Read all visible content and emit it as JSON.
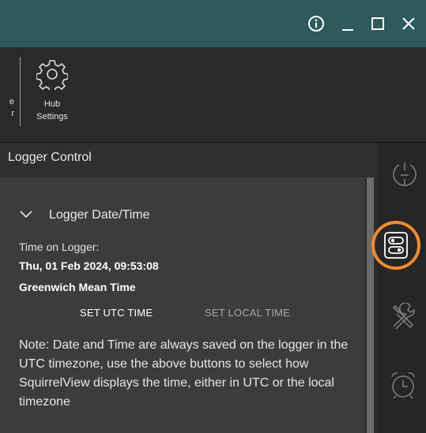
{
  "ribbon": {
    "partial_label": "e\nr",
    "hub_settings_label": "Hub\nSettings"
  },
  "panel": {
    "title": "Logger Control"
  },
  "section": {
    "title": "Logger Date/Time",
    "time_label": "Time on Logger:",
    "time_value": "Thu, 01 Feb 2024, 09:53:08",
    "timezone": "Greenwich Mean Time",
    "set_utc_label": "SET UTC TIME",
    "set_local_label": "SET LOCAL TIME",
    "note": "Note: Date and Time are always saved on the logger in the UTC timezone, use the above buttons to select how SquirrelView displays the time, either in UTC or the local timezone"
  },
  "colors": {
    "title_bar": "#2e5a5d",
    "highlight": "#f08c2e"
  },
  "icons": [
    "info-icon",
    "minimize-icon",
    "maximize-icon",
    "close-icon",
    "gear-icon",
    "chevron-down-icon",
    "gauge-icon",
    "logger-control-icon",
    "tools-icon",
    "alarm-clock-icon"
  ]
}
